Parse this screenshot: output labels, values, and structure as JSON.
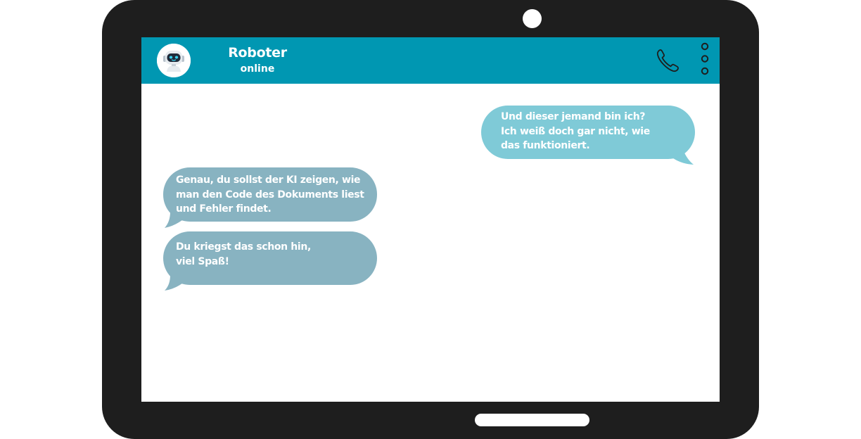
{
  "header": {
    "contact_name": "Roboter",
    "status": "online",
    "avatar_icon": "robot-avatar-icon",
    "call_icon": "phone-icon",
    "menu_icon": "more-vertical-icon",
    "color": "#0097b2"
  },
  "messages": [
    {
      "direction": "outgoing",
      "text": "Und dieser jemand bin ich?\nIch weiß doch gar nicht, wie\ndas funktioniert.",
      "color": "#7fcad7"
    },
    {
      "direction": "incoming",
      "text": "Genau, du sollst der KI zeigen, wie\nman den Code des Dokuments liest\nund Fehler findet.",
      "color": "#88b3c1"
    },
    {
      "direction": "incoming",
      "text": "Du kriegst das schon hin,\nviel Spaß!",
      "color": "#88b3c1"
    }
  ],
  "device": {
    "frame_color": "#1e1e1e"
  }
}
